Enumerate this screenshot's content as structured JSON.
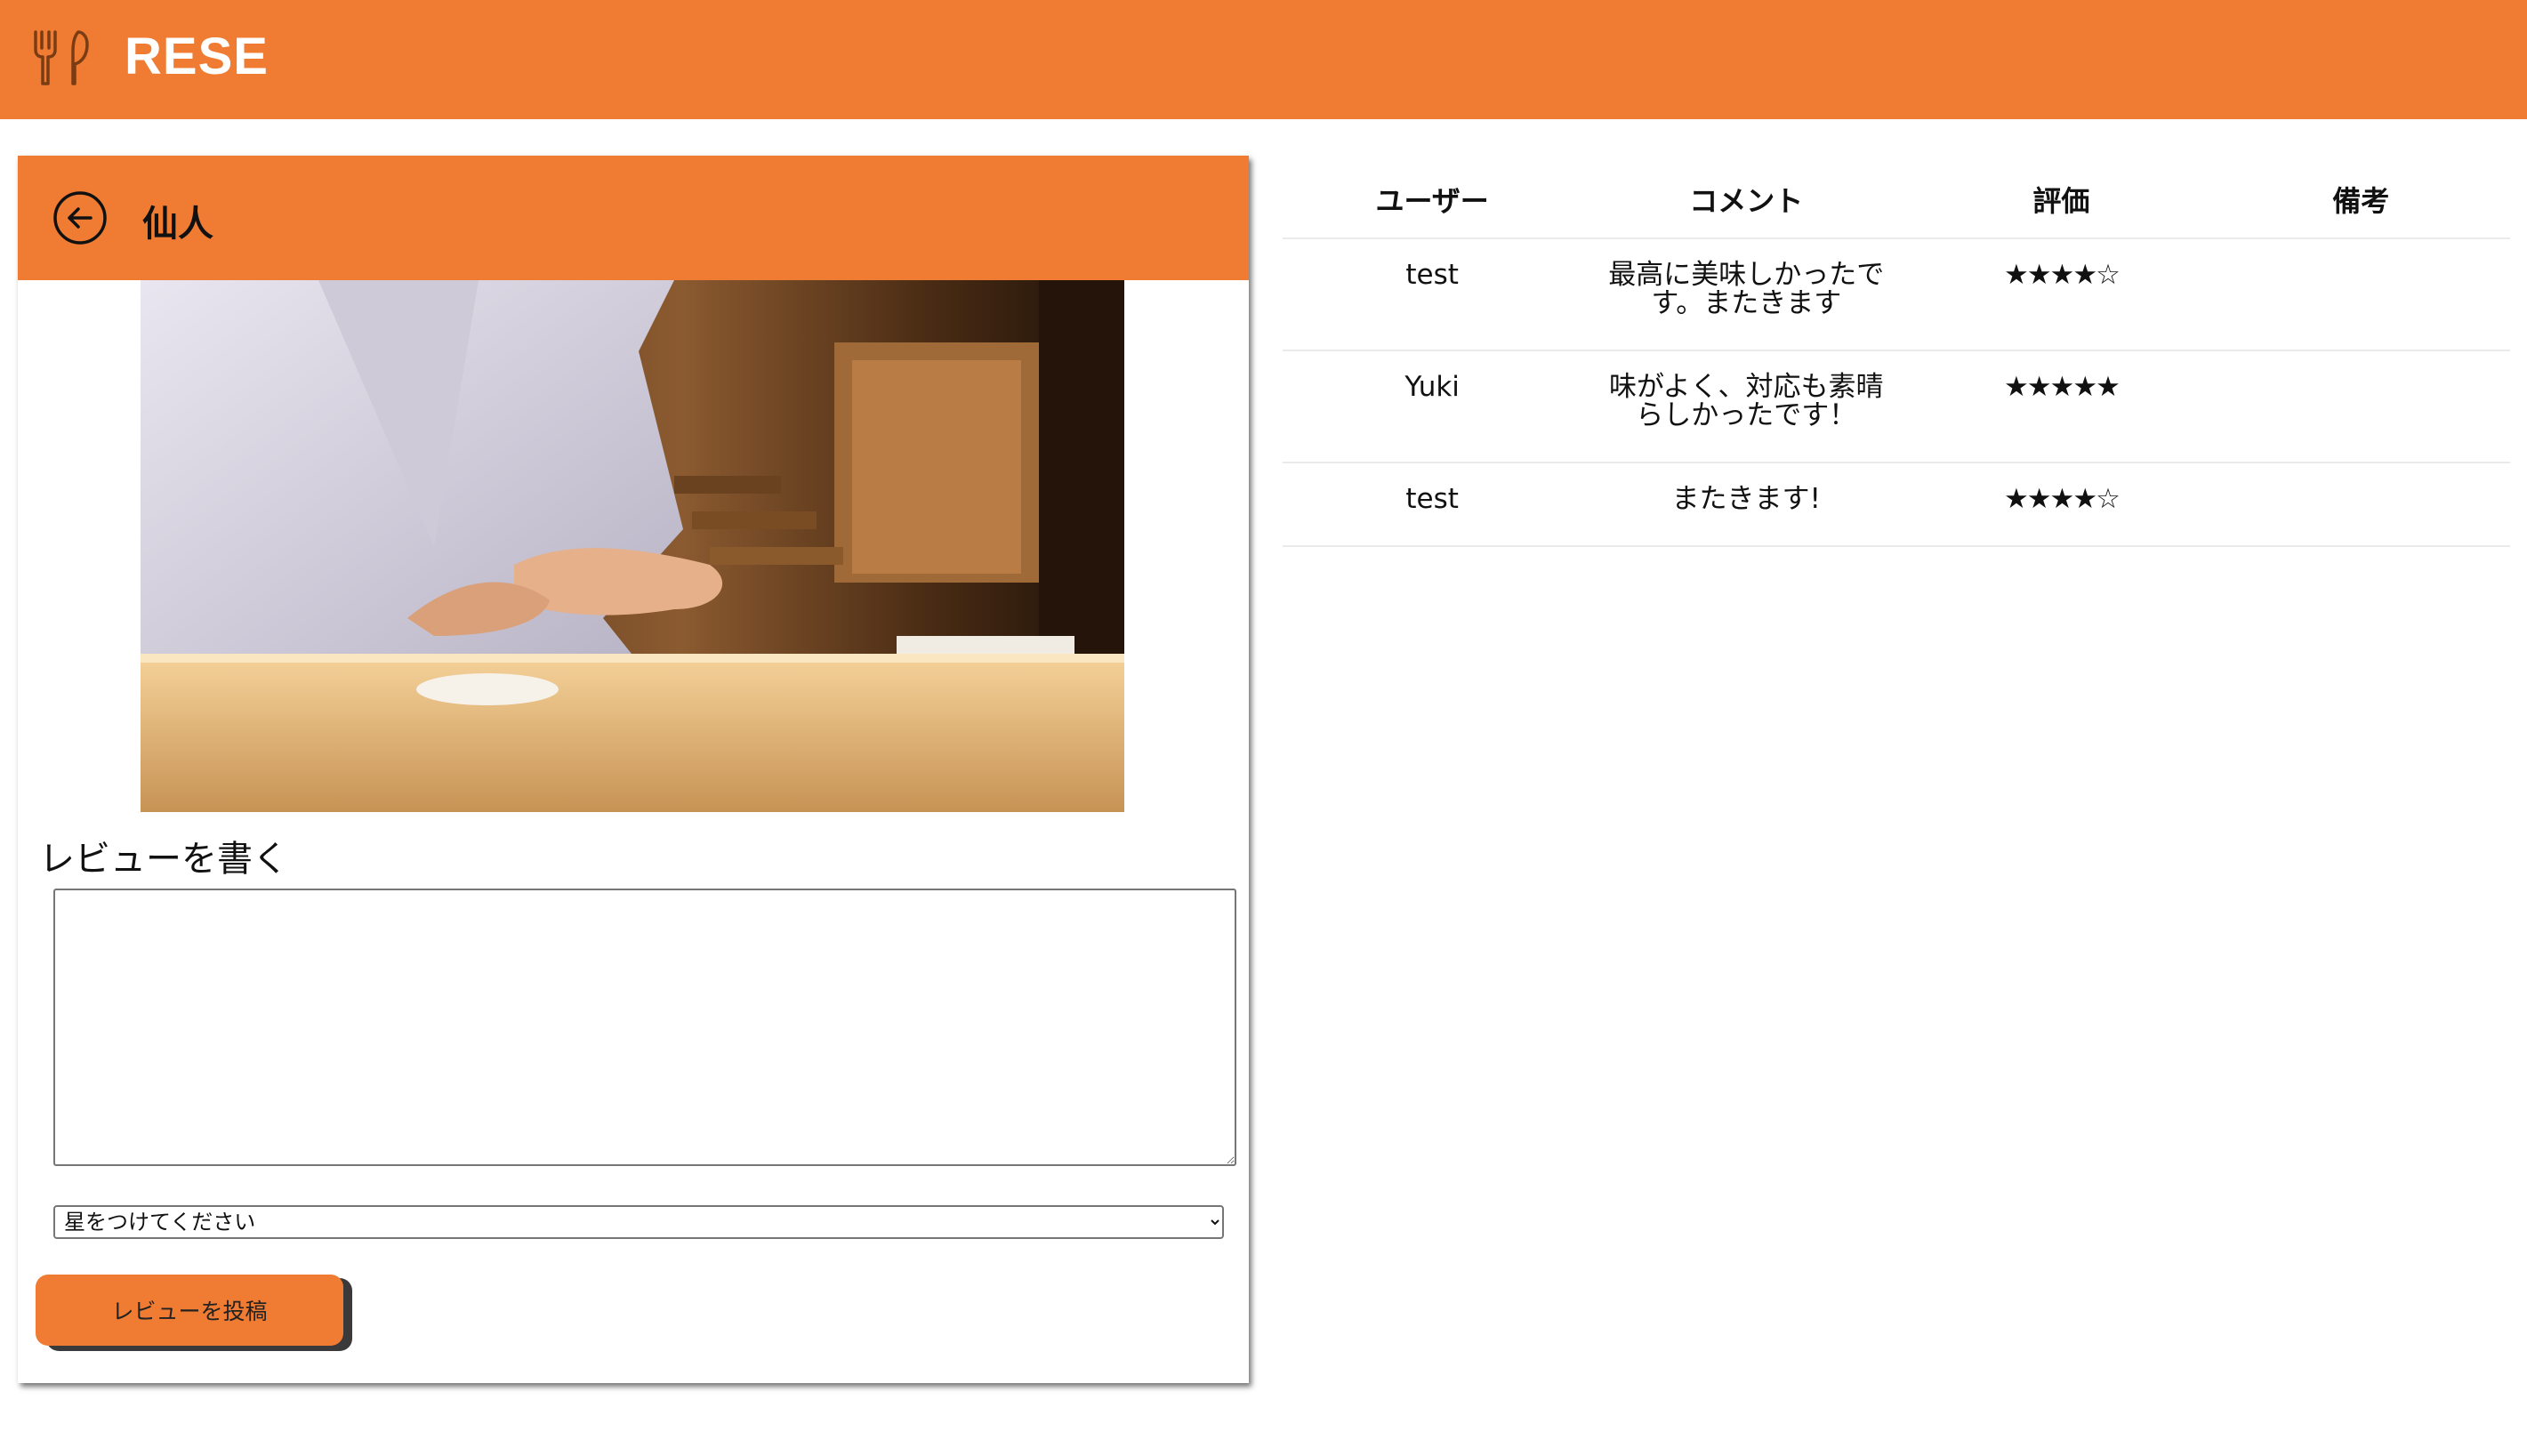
{
  "app": {
    "title": "RESE",
    "logo_icon": "fork-knife-icon",
    "brand_color": "#f07c33"
  },
  "shop": {
    "name": "仙人",
    "back_icon": "arrow-left-circle-icon"
  },
  "review_form": {
    "heading": "レビューを書く",
    "comment_value": "",
    "rating_selected": "星をつけてください",
    "submit_label": "レビューを投稿"
  },
  "reviews": {
    "headers": {
      "user": "ユーザー",
      "comment": "コメント",
      "rating": "評価",
      "note": "備考"
    },
    "rows": [
      {
        "user": "test",
        "comment": "最高に美味しかったです。またきます",
        "stars": "★★★★☆",
        "rating": 4,
        "note": ""
      },
      {
        "user": "Yuki",
        "comment": "味がよく、対応も素晴らしかったです！",
        "stars": "★★★★★",
        "rating": 5,
        "note": ""
      },
      {
        "user": "test",
        "comment": "またきます!",
        "stars": "★★★★☆",
        "rating": 4,
        "note": ""
      }
    ]
  }
}
